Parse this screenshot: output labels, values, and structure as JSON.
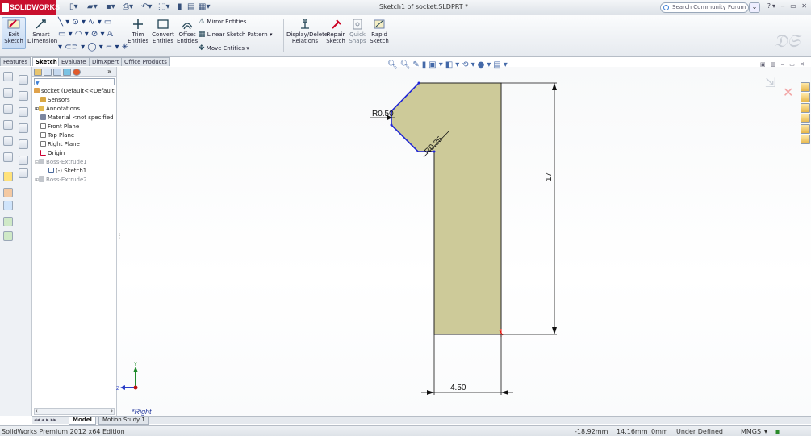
{
  "app": {
    "logo_text": "SOLIDWORKS",
    "window_title": "Sketch1 of socket.SLDPRT *",
    "search_placeholder": "Search Community Forum"
  },
  "commands": {
    "exit_sketch": "Exit Sketch",
    "smart_dimension": "Smart Dimension",
    "trim_entities": "Trim Entities",
    "convert_entities": "Convert Entities",
    "offset_entities": "Offset Entities",
    "mirror_entities": "Mirror Entities",
    "linear_sketch_pattern": "Linear Sketch Pattern",
    "move_entities": "Move Entities",
    "display_delete_relations": "Display/Delete Relations",
    "repair_sketch": "Repair Sketch",
    "quick_snaps": "Quick Snaps",
    "rapid_sketch": "Rapid Sketch"
  },
  "tabs": [
    "Features",
    "Sketch",
    "Evaluate",
    "DimXpert",
    "Office Products"
  ],
  "active_tab": "Sketch",
  "tree": {
    "root": "socket  (Default<<Default",
    "items": [
      {
        "label": "Sensors",
        "dim": false
      },
      {
        "label": "Annotations",
        "dim": false
      },
      {
        "label": "Material <not specified",
        "dim": false
      },
      {
        "label": "Front Plane",
        "dim": false
      },
      {
        "label": "Top Plane",
        "dim": false
      },
      {
        "label": "Right Plane",
        "dim": false
      },
      {
        "label": "Origin",
        "dim": false
      },
      {
        "label": "Boss-Extrude1",
        "dim": true
      },
      {
        "label": "(-) Sketch1",
        "dim": false
      },
      {
        "label": "Boss-Extrude2",
        "dim": true
      }
    ]
  },
  "sketch": {
    "fill_color": "#cdca99",
    "dim_radius_top": "R0.50",
    "dim_radius_chamfer": "R0.25",
    "dim_height": "17",
    "dim_width": "4.50"
  },
  "view": {
    "orientation_label": "*Right",
    "triad_y": "Y",
    "triad_z": "Z"
  },
  "model_tabs": [
    "Model",
    "Motion Study 1"
  ],
  "active_model_tab": "Model",
  "status": {
    "edition": "SolidWorks Premium 2012 x64 Edition",
    "coord_x": "-18.92mm",
    "coord_y": "14.16mm",
    "coord_z": "0mm",
    "state": "Under Defined",
    "units": "MMGS"
  }
}
